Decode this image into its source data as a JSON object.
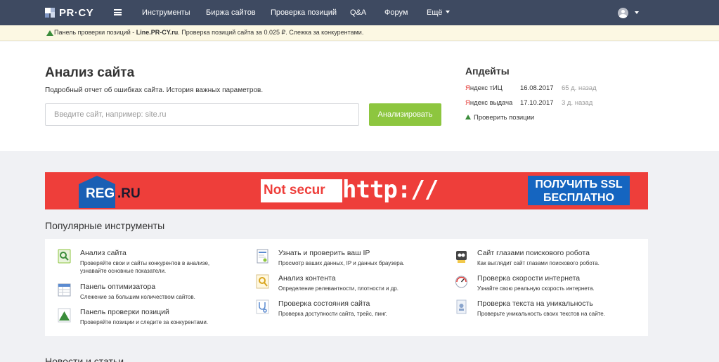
{
  "brand": {
    "name": "PR·CY"
  },
  "nav": {
    "items": [
      "Инструменты",
      "Биржа сайтов",
      "Проверка позиций",
      "Q&A",
      "Форум",
      "Ещё"
    ]
  },
  "promo": {
    "prefix": "Панель проверки позиций - ",
    "link": "Line.PR-CY.ru",
    "suffix": ". Проверка позиций сайта за 0.025 ₽. Слежка за конкурентами."
  },
  "hero": {
    "title": "Анализ сайта",
    "subtitle": "Подробный отчет об ошибках сайта. История важных параметров.",
    "search_placeholder": "Введите сайт, например: site.ru",
    "analyze_label": "Анализировать"
  },
  "updates": {
    "title": "Апдейты",
    "rows": [
      {
        "ya": "Я",
        "name": "ндекс тИЦ",
        "date": "16.08.2017",
        "ago": "65 д. назад"
      },
      {
        "ya": "Я",
        "name": "ндекс выдача",
        "date": "17.10.2017",
        "ago": "3 д. назад"
      }
    ],
    "check_label": "Проверить позиции"
  },
  "banner": {
    "reg": "REG",
    "reg_ru": ".RU",
    "not_secure": "Not secur",
    "http": "http://",
    "ssl_line1": "ПОЛУЧИТЬ SSL",
    "ssl_line2": "БЕСПЛАТНО"
  },
  "tools": {
    "title": "Популярные инструменты",
    "items": [
      {
        "title": "Анализ сайта",
        "desc1": "Проверяйте свои и сайты конкурентов в анализе,",
        "desc2": "узнавайте основные показатели.",
        "icon": "magnifier-icon"
      },
      {
        "title": "Панель оптимизатора",
        "desc1": "Слежение за большим количеством сайтов.",
        "desc2": "",
        "icon": "table-icon"
      },
      {
        "title": "Панель проверки позиций",
        "desc1": "Проверяйте позиции и следите за конкурентами.",
        "desc2": "",
        "icon": "positions-icon"
      },
      {
        "title": "Узнать и проверить ваш IP",
        "desc1": "Просмотр ваших данных, IP и данных браузера.",
        "desc2": "",
        "icon": "ip-icon"
      },
      {
        "title": "Анализ контента",
        "desc1": "Определение релевантности, плотности и др.",
        "desc2": "",
        "icon": "content-icon"
      },
      {
        "title": "Проверка состояния сайта",
        "desc1": "Проверка доступности сайта, трейс, пинг.",
        "desc2": "",
        "icon": "stethoscope-icon"
      },
      {
        "title": "Сайт глазами поискового робота",
        "desc1": "Как выглядит сайт глазами поискового робота.",
        "desc2": "",
        "icon": "robot-icon"
      },
      {
        "title": "Проверка скорости интернета",
        "desc1": "Узнайте свою реальную скорость интернета.",
        "desc2": "",
        "icon": "speedometer-icon"
      },
      {
        "title": "Проверка текста на уникальность",
        "desc1": "Проверьте уникальность своих текстов на сайте.",
        "desc2": "",
        "icon": "uniqueness-icon"
      }
    ]
  },
  "news": {
    "title": "Новости и статьи"
  },
  "colors": {
    "navbar": "#3e4a61",
    "accent_green": "#8dc63f",
    "banner_red": "#ee3e3a",
    "yandex_red": "#e3322d"
  }
}
